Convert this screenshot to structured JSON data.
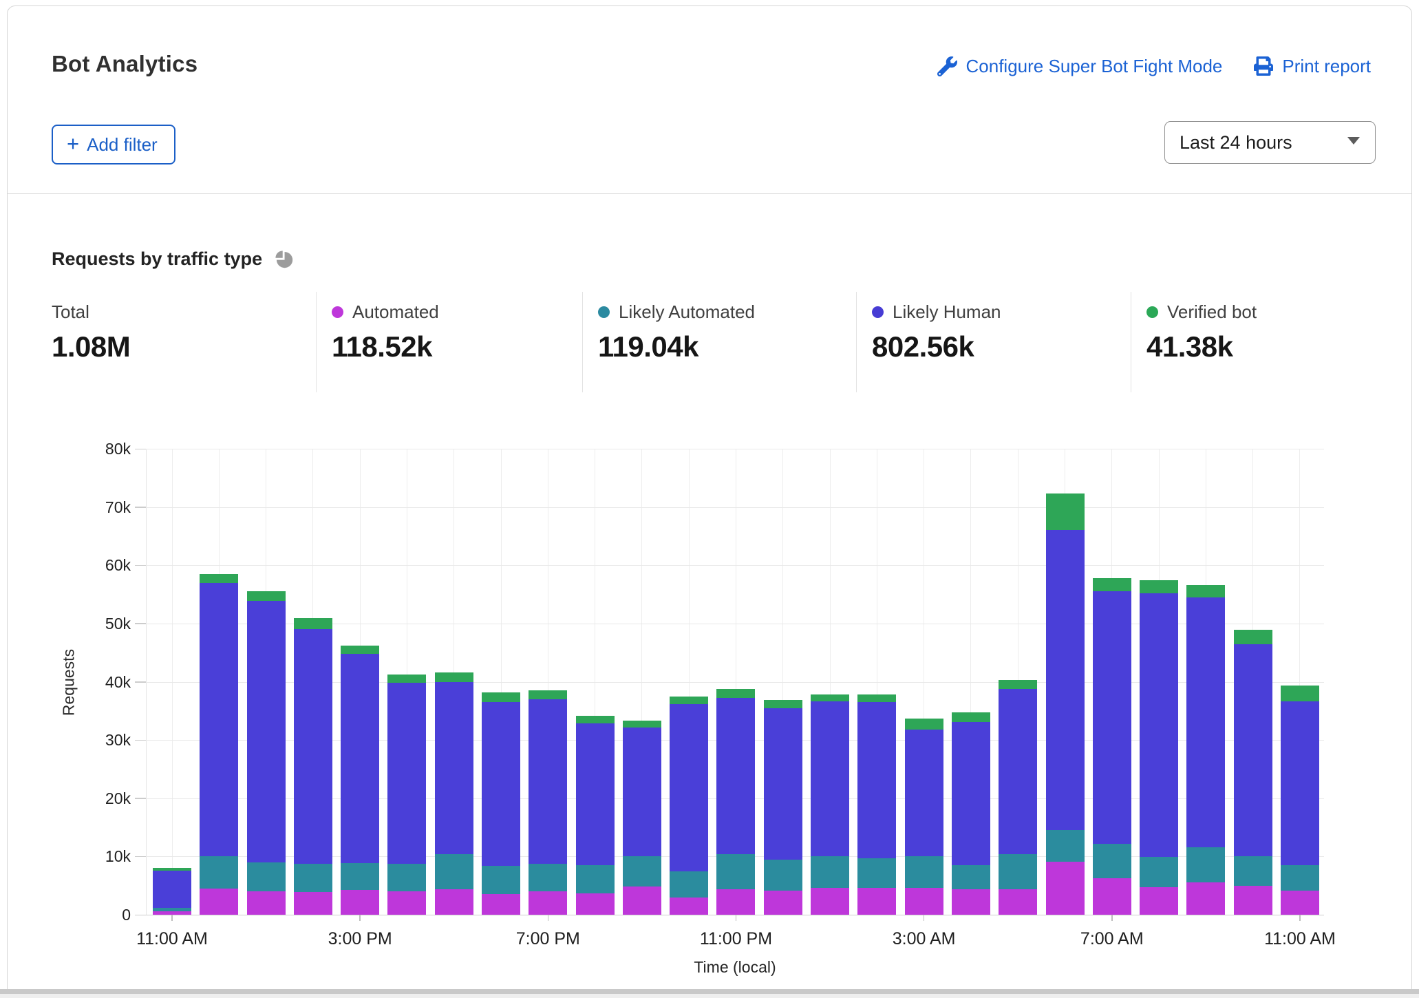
{
  "header": {
    "title": "Bot Analytics",
    "configure_link": "Configure Super Bot Fight Mode",
    "print_link": "Print report",
    "add_filter_plus": "+",
    "add_filter_label": "Add filter",
    "time_range_selected": "Last 24 hours"
  },
  "section": {
    "heading": "Requests by traffic type"
  },
  "stats": {
    "items": [
      {
        "label": "Total",
        "value": "1.08M",
        "dot_color": null
      },
      {
        "label": "Automated",
        "value": "118.52k",
        "dot_color": "#be37da"
      },
      {
        "label": "Likely Automated",
        "value": "119.04k",
        "dot_color": "#2b8aa0"
      },
      {
        "label": "Likely Human",
        "value": "802.56k",
        "dot_color": "#473cd4"
      },
      {
        "label": "Verified bot",
        "value": "41.38k",
        "dot_color": "#2ba857"
      }
    ]
  },
  "chart_data": {
    "type": "bar",
    "stacked": true,
    "title": "Requests by traffic type",
    "xlabel": "Time (local)",
    "ylabel": "Requests",
    "ylim": [
      0,
      80000
    ],
    "grid": true,
    "y_tick_labels": [
      "0",
      "10k",
      "20k",
      "30k",
      "40k",
      "50k",
      "60k",
      "70k",
      "80k"
    ],
    "x_tick_labels": [
      "11:00 AM",
      "3:00 PM",
      "7:00 PM",
      "11:00 PM",
      "3:00 AM",
      "7:00 AM",
      "11:00 AM"
    ],
    "x_tick_indices": [
      0,
      4,
      8,
      12,
      16,
      20,
      24
    ],
    "categories": [
      "11:00 AM",
      "12:00 PM",
      "1:00 PM",
      "2:00 PM",
      "3:00 PM",
      "4:00 PM",
      "5:00 PM",
      "6:00 PM",
      "7:00 PM",
      "8:00 PM",
      "9:00 PM",
      "10:00 PM",
      "11:00 PM",
      "12:00 AM",
      "1:00 AM",
      "2:00 AM",
      "3:00 AM",
      "4:00 AM",
      "5:00 AM",
      "6:00 AM",
      "7:00 AM",
      "8:00 AM",
      "9:00 AM",
      "10:00 AM",
      "11:00 AM"
    ],
    "values_unit": "thousands of requests",
    "series": [
      {
        "name": "Automated",
        "color": "#be37da",
        "values_k": [
          0.6,
          4.5,
          4.0,
          3.9,
          4.3,
          4.0,
          4.4,
          3.5,
          4.0,
          3.7,
          4.8,
          3.0,
          4.4,
          4.1,
          4.6,
          4.6,
          4.6,
          4.4,
          4.4,
          9.1,
          6.3,
          4.7,
          5.6,
          5.0,
          4.1
        ]
      },
      {
        "name": "Likely Automated",
        "color": "#2b8c9e",
        "values_k": [
          0.6,
          5.5,
          5.0,
          4.9,
          4.6,
          4.8,
          6.0,
          4.9,
          4.7,
          4.8,
          5.3,
          4.4,
          6.0,
          5.4,
          5.4,
          5.1,
          5.4,
          4.1,
          6.0,
          5.4,
          5.9,
          5.2,
          6.0,
          5.1,
          4.4
        ]
      },
      {
        "name": "Likely Human",
        "color": "#4a3fd8",
        "values_k": [
          6.4,
          47.0,
          44.9,
          40.2,
          35.9,
          31.0,
          29.5,
          28.1,
          28.3,
          24.4,
          22.1,
          28.8,
          26.8,
          25.9,
          26.6,
          26.8,
          21.8,
          24.6,
          28.4,
          51.6,
          43.4,
          45.3,
          42.9,
          36.4,
          28.1
        ]
      },
      {
        "name": "Verified bot",
        "color": "#2ea657",
        "values_k": [
          0.4,
          1.5,
          1.7,
          1.9,
          1.4,
          1.5,
          1.7,
          1.7,
          1.5,
          1.3,
          1.1,
          1.3,
          1.6,
          1.5,
          1.2,
          1.3,
          1.9,
          1.6,
          1.5,
          6.2,
          2.2,
          2.2,
          2.1,
          2.4,
          2.8
        ]
      }
    ],
    "totals_k": [
      8.0,
      58.5,
      55.6,
      50.9,
      46.2,
      41.3,
      41.6,
      38.2,
      38.5,
      34.2,
      33.3,
      37.5,
      38.8,
      36.9,
      37.8,
      37.8,
      33.7,
      34.7,
      40.3,
      72.3,
      57.8,
      57.4,
      56.6,
      48.9,
      39.4
    ]
  }
}
